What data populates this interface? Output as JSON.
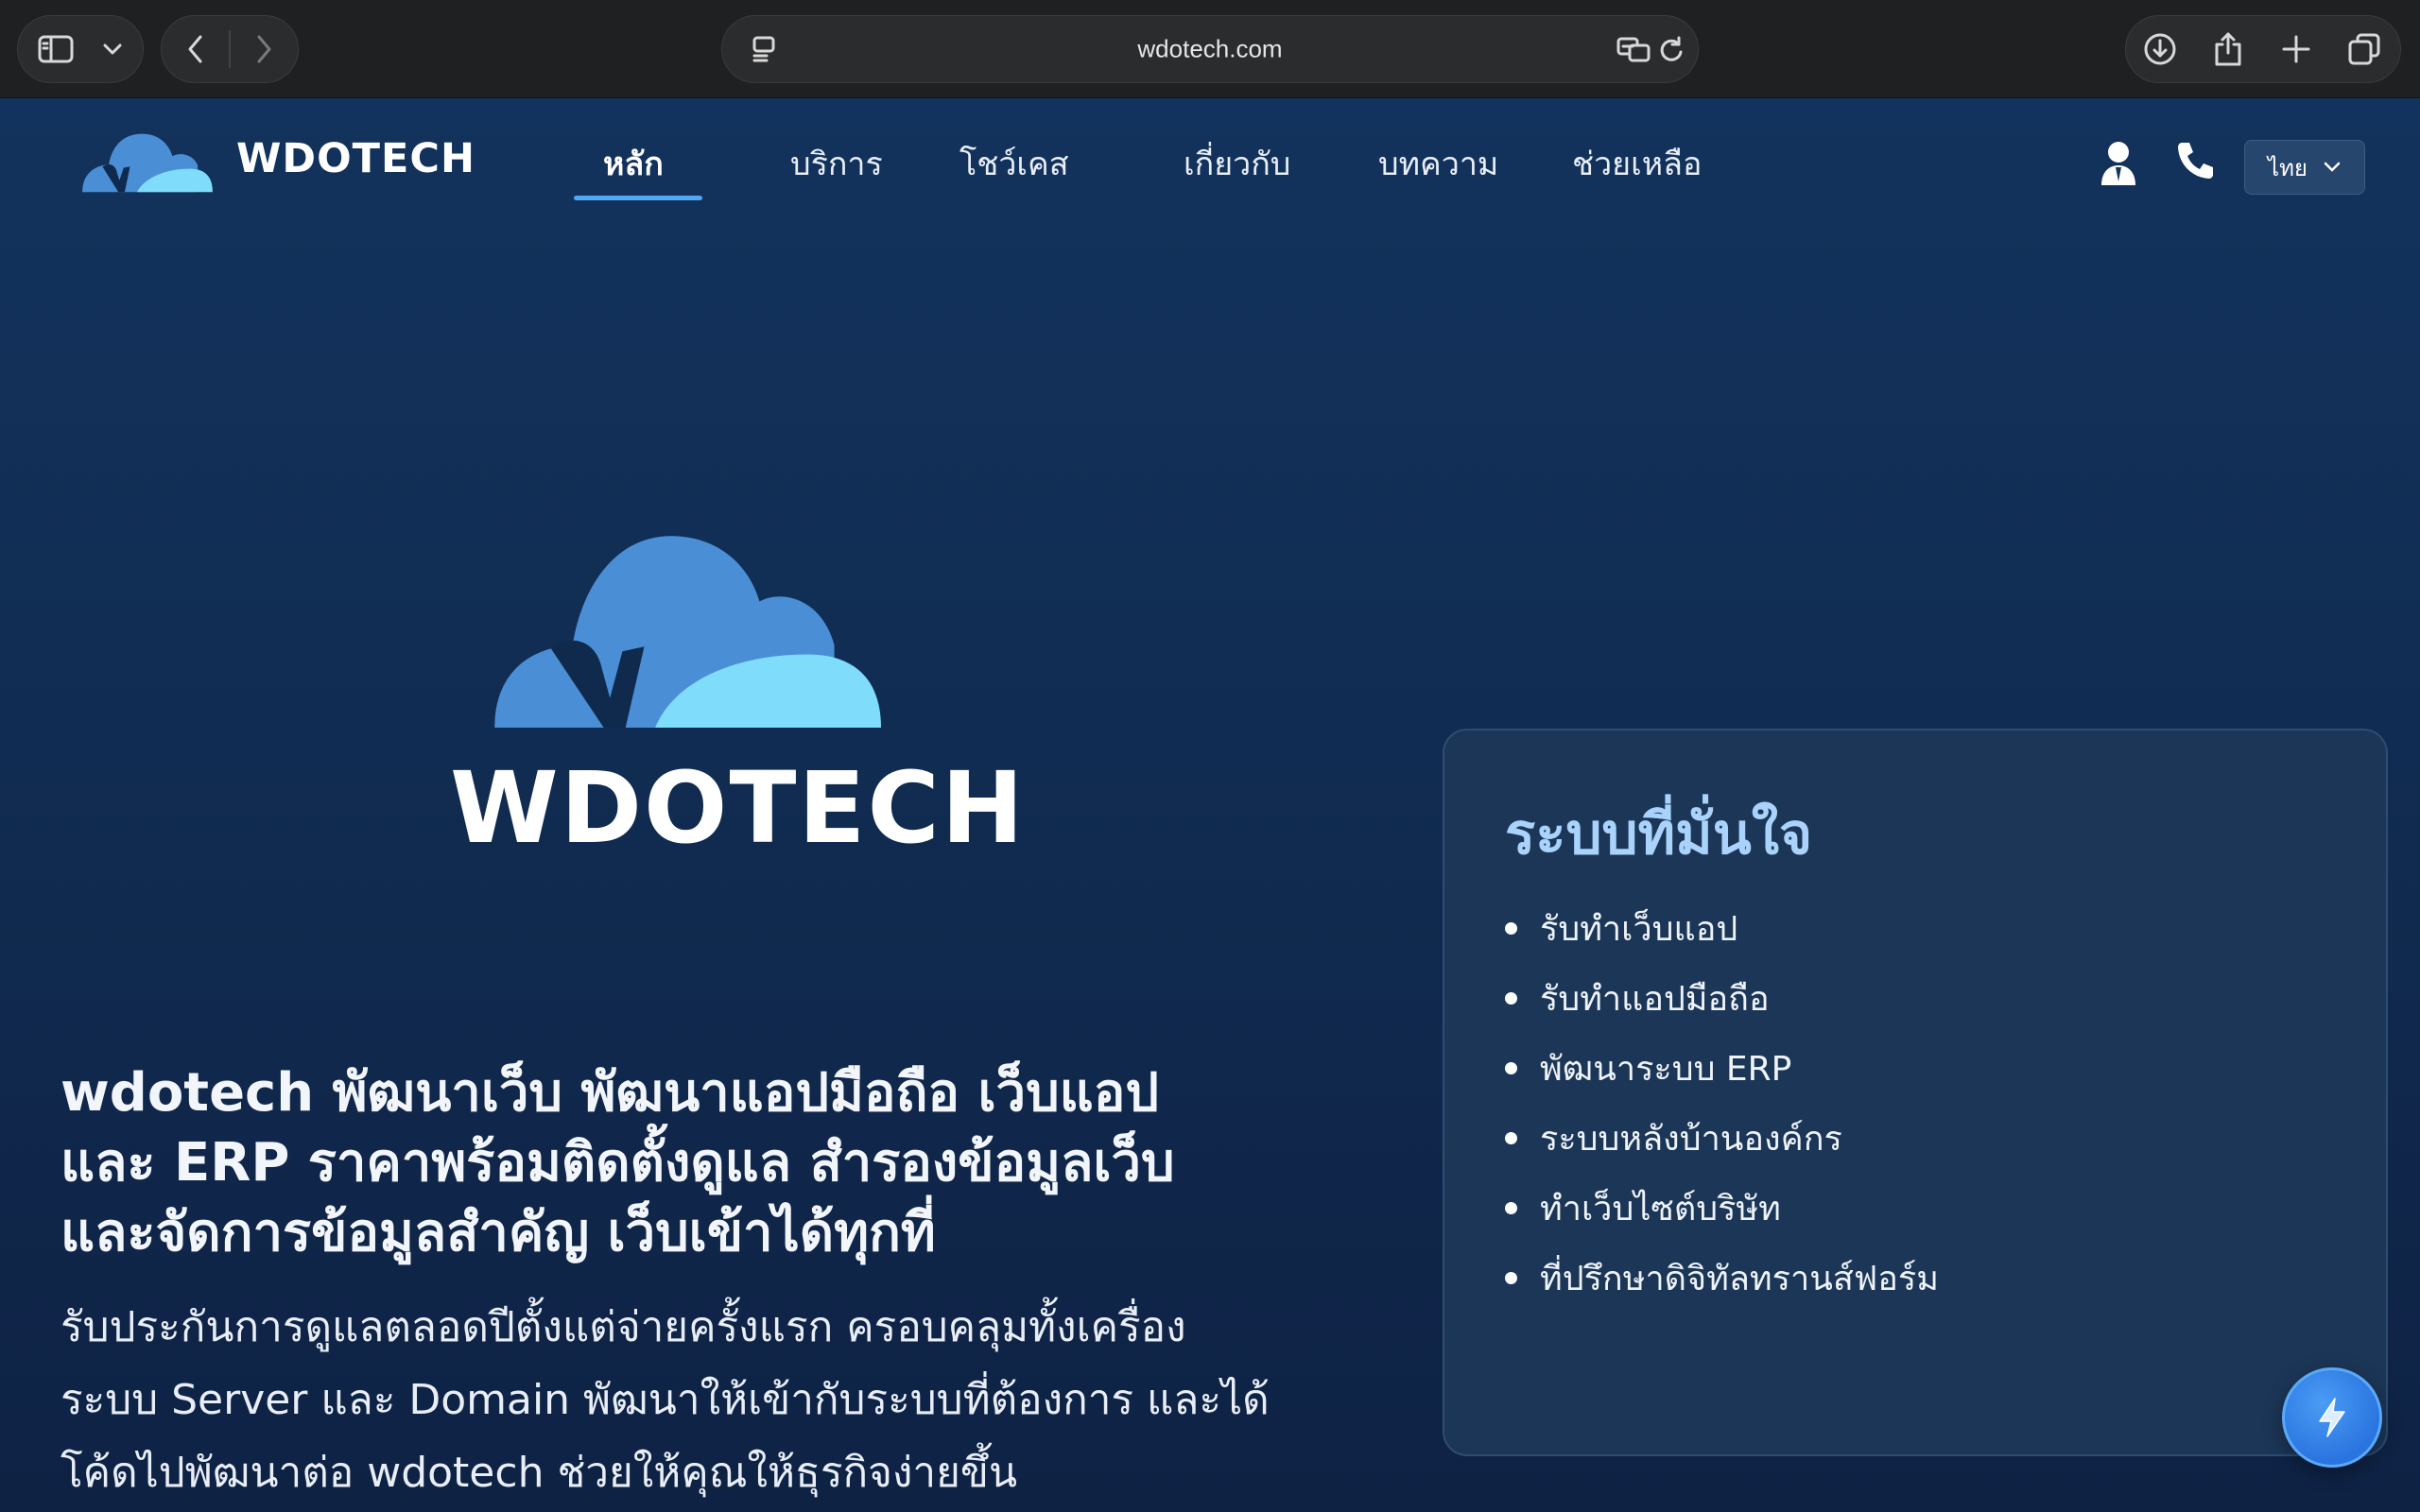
{
  "browser": {
    "url": "wdotech.com",
    "icons": [
      "sidebar-icon",
      "chevron-down-icon",
      "back-icon",
      "forward-icon",
      "reader-icon",
      "translate-icon",
      "reload-icon",
      "download-icon",
      "share-icon",
      "new-tab-icon",
      "tabs-overview-icon"
    ]
  },
  "header": {
    "brand": "WDOTECH",
    "nav": [
      {
        "label": "หลัก",
        "active": true
      },
      {
        "label": "บริการ",
        "active": false
      },
      {
        "label": "โชว์เคส",
        "active": false
      },
      {
        "label": "เกี่ยวกับ",
        "active": false
      },
      {
        "label": "บทความ",
        "active": false
      },
      {
        "label": "ช่วยเหลือ",
        "active": false
      }
    ],
    "language": "ไทย",
    "icons": [
      "user-icon",
      "phone-icon"
    ]
  },
  "hero": {
    "brand": "WDOTECH",
    "title_lines": [
      "wdotech พัฒนาเว็บ พัฒนาแอปมือถือ เว็บแอป",
      "และ ERP ราคาพร้อมติดตั้งดูแล สำรองข้อมูลเว็บ",
      "และจัดการข้อมูลสำคัญ เว็บเข้าได้ทุกที่"
    ],
    "desc_lines": [
      "รับประกันการดูแลตลอดปีตั้งแต่จ่ายครั้งแรก ครอบคลุมทั้งเครื่อง",
      "ระบบ Server และ Domain พัฒนาให้เข้ากับระบบที่ต้องการ และได้",
      "โค้ดไปพัฒนาต่อ wdotech ช่วยให้คุณให้ธุรกิจง่ายขึ้น"
    ]
  },
  "features": {
    "title": "ระบบที่มั่นใจ",
    "items": [
      "รับทำเว็บแอป",
      "รับทำแอปมือถือ",
      "พัฒนาระบบ ERP",
      "ระบบหลังบ้านองค์กร",
      "ทำเว็บไซต์บริษัท",
      "ที่ปรึกษาดิจิทัลทรานส์ฟอร์ม"
    ]
  },
  "fab": {
    "icon": "lightning-icon"
  },
  "colors": {
    "accent": "#4fa8f2",
    "card_title": "#a9d3fb",
    "logo_dark": "#4a8fd6",
    "logo_light": "#7fdcfb"
  }
}
